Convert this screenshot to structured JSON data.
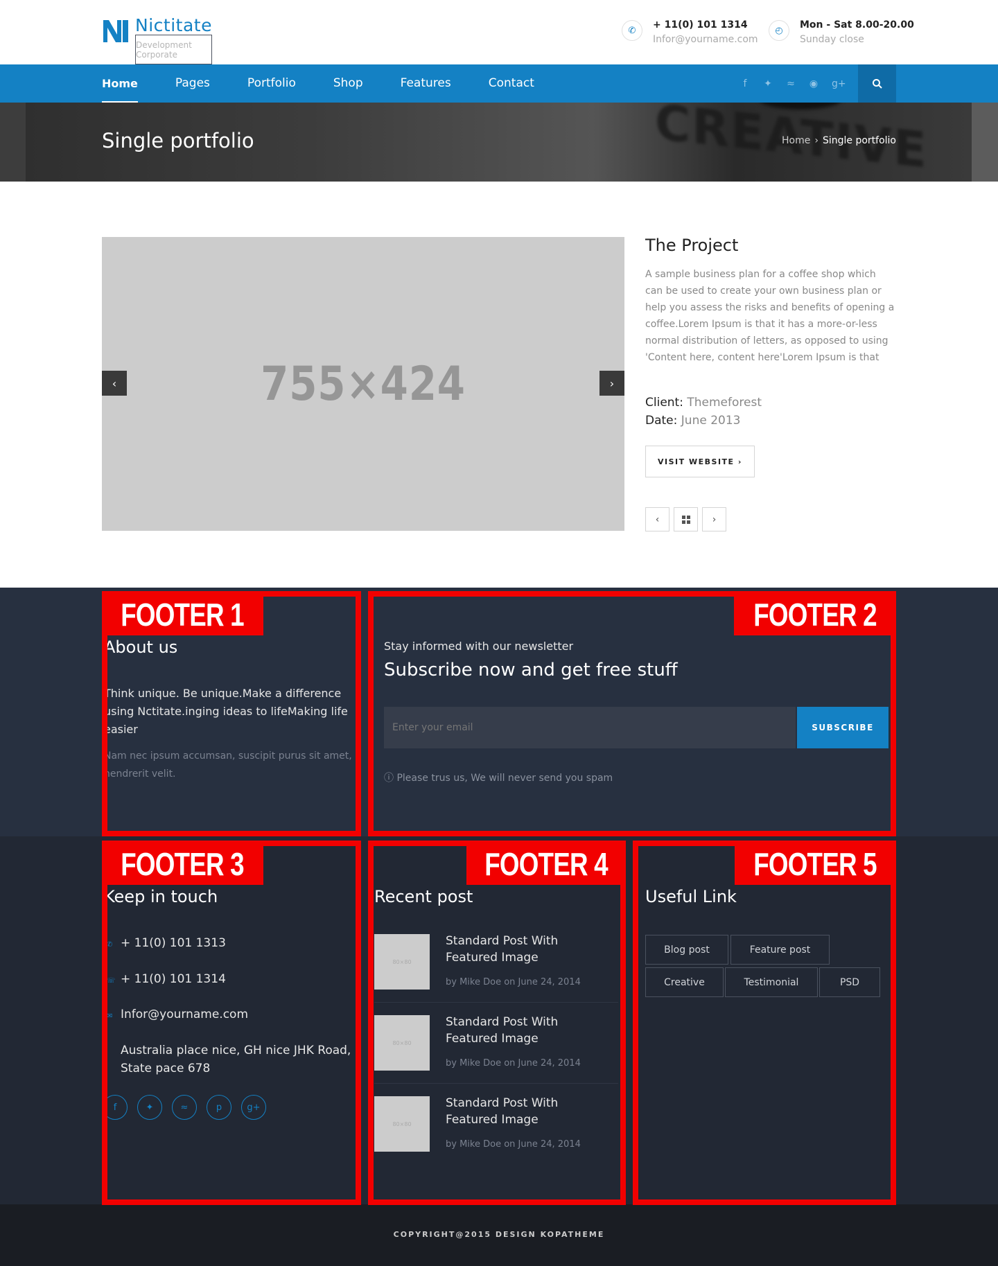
{
  "brand": {
    "name": "Nictitate",
    "tagline": "Development Corporate"
  },
  "contact_header": {
    "phone": "+ 11(0) 101 1314",
    "email": "Infor@yourname.com",
    "hours": "Mon - Sat 8.00-20.00",
    "closed": "Sunday close"
  },
  "nav": {
    "items": [
      "Home",
      "Pages",
      "Portfolio",
      "Shop",
      "Features",
      "Contact"
    ],
    "active": "Home",
    "social_icons": [
      "facebook-icon",
      "twitter-icon",
      "rss-icon",
      "dribbble-icon",
      "google-plus-icon"
    ]
  },
  "banner": {
    "title": "Single portfolio",
    "breadcrumb": [
      "Home",
      "Single portfolio"
    ]
  },
  "slider": {
    "placeholder": "755×424"
  },
  "project": {
    "title": "The Project",
    "description": "A sample business plan for a coffee shop which can be used to create your own business plan or help you assess the risks and benefits of opening a coffee.Lorem Ipsum is that it has a more-or-less normal distribution of letters, as opposed to using 'Content here, content here'Lorem Ipsum is that",
    "client_label": "Client:",
    "client": "Themeforest",
    "date_label": "Date:",
    "date": "June 2013",
    "visit_button": "VISIT WEBSITE"
  },
  "footer_labels": [
    "FOOTER 1",
    "FOOTER 2",
    "FOOTER 3",
    "FOOTER 4",
    "FOOTER 5"
  ],
  "footer1": {
    "title": "About us",
    "text": "Think unique. Be unique.Make a difference using Nctitate.inging ideas to lifeMaking life easier",
    "muted": "Nam nec ipsum accumsan, suscipit purus sit amet, hendrerit velit."
  },
  "footer2": {
    "kicker": "Stay informed with our newsletter",
    "title": "Subscribe now and get free stuff",
    "email_placeholder": "Enter your email",
    "subscribe": "SUBSCRIBE",
    "note": "Please trus us, We will never send you spam"
  },
  "footer3": {
    "title": "Keep in touch",
    "phone1": "+ 11(0) 101 1313",
    "phone2": "+ 11(0) 101 1314",
    "email": "Infor@yourname.com",
    "address": "Australia place nice, GH nice JHK Road, State pace 678"
  },
  "footer4": {
    "title": "Recent post",
    "posts": [
      {
        "title": "Standard Post With Featured Image",
        "meta": "by Mike Doe on June 24, 2014",
        "thumb": "80×80"
      },
      {
        "title": "Standard Post With Featured Image",
        "meta": "by Mike Doe on June 24, 2014",
        "thumb": "80×80"
      },
      {
        "title": "Standard Post With Featured Image",
        "meta": "by Mike Doe on June 24, 2014",
        "thumb": "80×80"
      }
    ]
  },
  "footer5": {
    "title": "Useful Link",
    "tags": [
      "Blog post",
      "Feature post",
      "Creative",
      "Testimonial",
      "PSD"
    ]
  },
  "copyright": "COPYRIGHT@2015 DESIGN KOPATHEME",
  "colors": {
    "brand_blue": "#1481c4",
    "footer_dark": "#273040",
    "highlight_red": "#f20000"
  }
}
